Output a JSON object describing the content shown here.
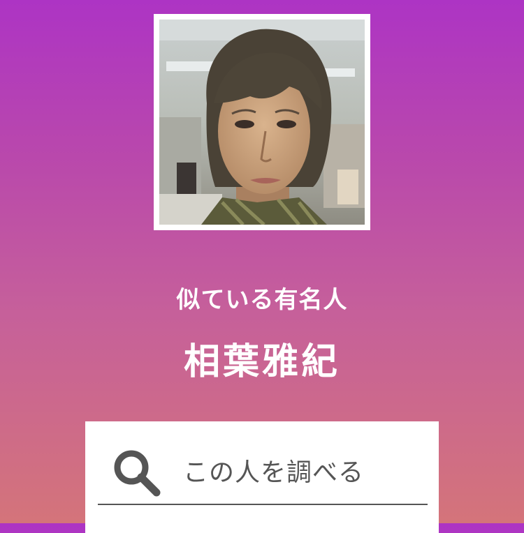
{
  "result": {
    "subtitle": "似ている有名人",
    "celebrity_name": "相葉雅紀"
  },
  "search": {
    "label": "この人を調べる",
    "icon": "search-icon"
  },
  "photo": {
    "icon": "portrait-photo"
  },
  "colors": {
    "gradient_top": "#ad34c4",
    "gradient_bottom": "#d4747a",
    "text": "#ffffff",
    "search_text": "#555555"
  }
}
